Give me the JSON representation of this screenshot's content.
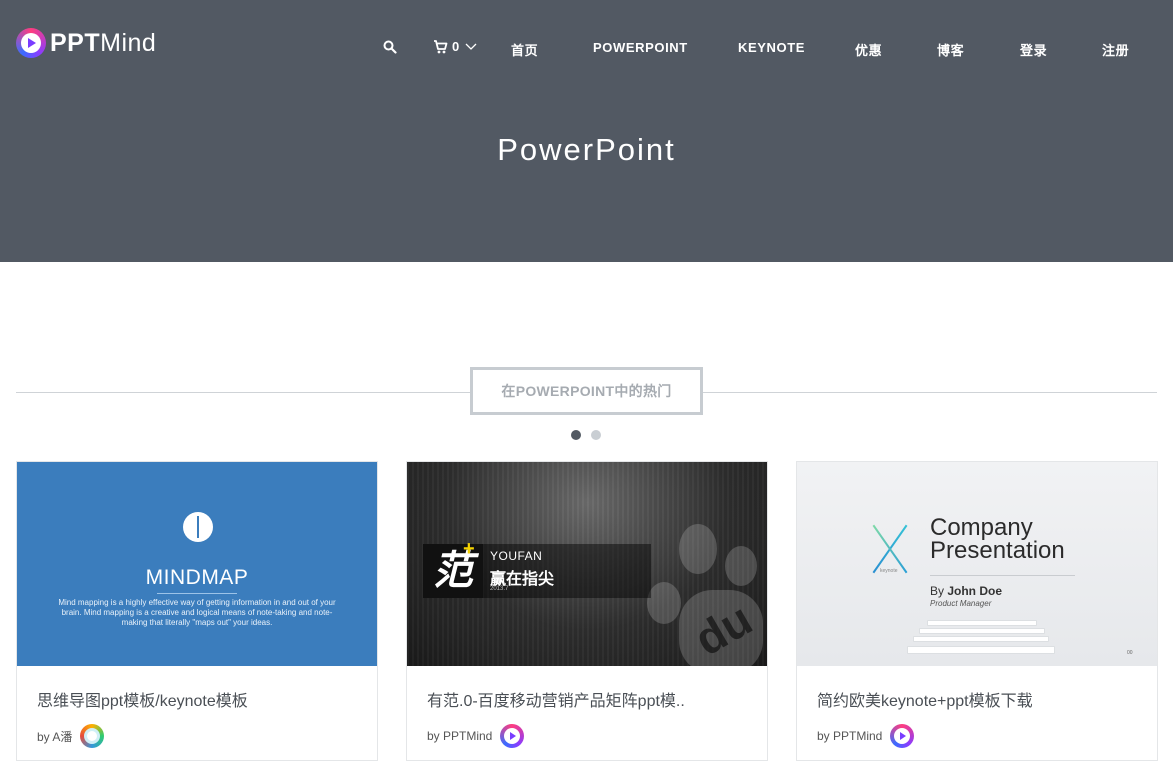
{
  "header": {
    "logo": {
      "bold": "PPT",
      "light": "Mind"
    },
    "cart_count": "0",
    "nav": [
      {
        "key": "home",
        "label": "首页"
      },
      {
        "key": "powerpoint",
        "label": "POWERPOINT"
      },
      {
        "key": "keynote",
        "label": "KEYNOTE"
      },
      {
        "key": "deals",
        "label": "优惠"
      },
      {
        "key": "blog",
        "label": "博客"
      },
      {
        "key": "login",
        "label": "登录"
      },
      {
        "key": "register",
        "label": "注册"
      }
    ],
    "icons": {
      "search": "search-icon",
      "cart": "cart-icon",
      "dropdown": "chevron-down-icon"
    },
    "background": "#525963"
  },
  "hero": {
    "title": "PowerPoint"
  },
  "section": {
    "heading": "在POWERPOINT中的热门",
    "pager": {
      "total": 2,
      "active": 1
    }
  },
  "cards": [
    {
      "title": "思维导图ppt模板/keynote模板",
      "by": "by A潘",
      "thumb": {
        "heading": "MINDMAP",
        "desc": "Mind mapping is a highly effective way of getting information in and out of your brain. Mind mapping is a creative and logical means of note-taking and note-making that literally \"maps out\" your ideas."
      }
    },
    {
      "title": "有范.0-百度移动营销产品矩阵ppt模..",
      "by": "by PPTMind",
      "thumb": {
        "glyph": "范",
        "brand": "YOUFAN",
        "slogan": "赢在指尖",
        "date": "2013.7",
        "mark": "du"
      }
    },
    {
      "title": "简约欧美keynote+ppt模板下载",
      "by": "by PPTMind",
      "thumb": {
        "line1": "Company",
        "line2": "Presentation",
        "by_prefix": "By ",
        "author": "John Doe",
        "role": "Product Manager",
        "x_label": "keynote",
        "page": "00"
      }
    }
  ],
  "colors": {
    "accent_blue": "#3b7dbd",
    "muted_text": "#a6abb1",
    "dot_active": "#535a63"
  }
}
